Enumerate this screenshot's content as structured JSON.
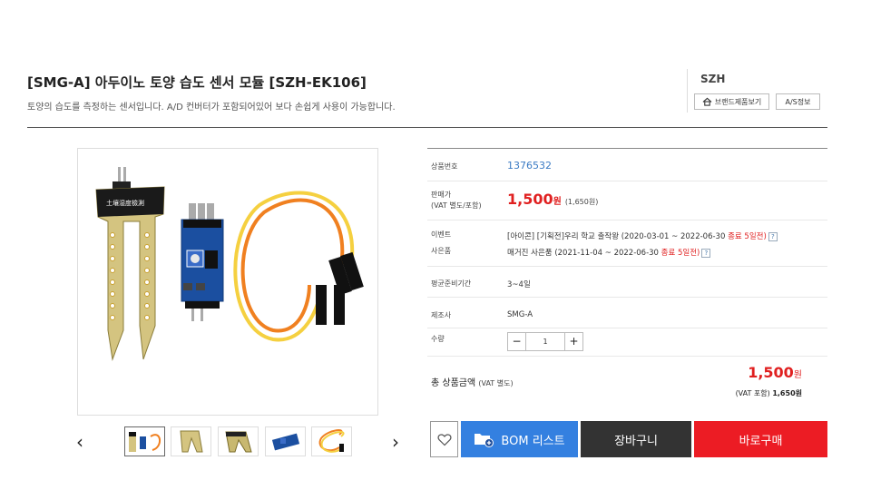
{
  "product": {
    "title": "[SMG-A] 아두이노 토양 습도 센서 모듈 [SZH-EK106]",
    "subtitle": "토양의 습도를 측정하는 센서입니다. A/D 컨버터가 포함되어있어 보다 손쉽게 사용이 가능합니다.",
    "image_chinese_label": "土壤湿度檢測"
  },
  "brand": {
    "name": "SZH",
    "products_button": "브랜드제품보기",
    "as_button": "A/S정보"
  },
  "info": {
    "product_number_label": "상품번호",
    "product_number": "1376532",
    "price_label_1": "판매가",
    "price_label_2": "(VAT 별도/포함)",
    "price": "1,500",
    "price_unit": "원",
    "price_vat": "(1,650원)",
    "event_label": "이벤트",
    "event_text": "[아이콘] [기획전]우리 학교 출작왕 (2020-03-01 ~ 2022-06-30 ",
    "event_end": "종료 5일전)",
    "gift_label": "사은품",
    "gift_text": "매거진 사은품 (2021-11-04 ~ 2022-06-30 ",
    "gift_end": "종료 5일전)",
    "help_mark": "?",
    "prep_label": "평균준비기간",
    "prep_value": "3~4일",
    "maker_label": "제조사",
    "maker_value": "SMG-A",
    "qty_label": "수량",
    "qty_minus": "−",
    "qty_value": "1",
    "qty_plus": "+"
  },
  "total": {
    "label": "총 상품금액",
    "label_small": "(VAT 별도)",
    "price": "1,500",
    "unit": "원",
    "vat_prefix": "(VAT 포함)",
    "vat_price": "1,650원"
  },
  "buttons": {
    "bom": "BOM 리스트",
    "cart": "장바구니",
    "buy": "바로구매"
  },
  "gallery": {
    "prev": "‹",
    "next": "›"
  },
  "colors": {
    "accent_red": "#e02020",
    "bom_blue": "#3480e0",
    "cart_dark": "#333333",
    "buy_red": "#ec1c24",
    "product_number_blue": "#3b7bc4"
  }
}
